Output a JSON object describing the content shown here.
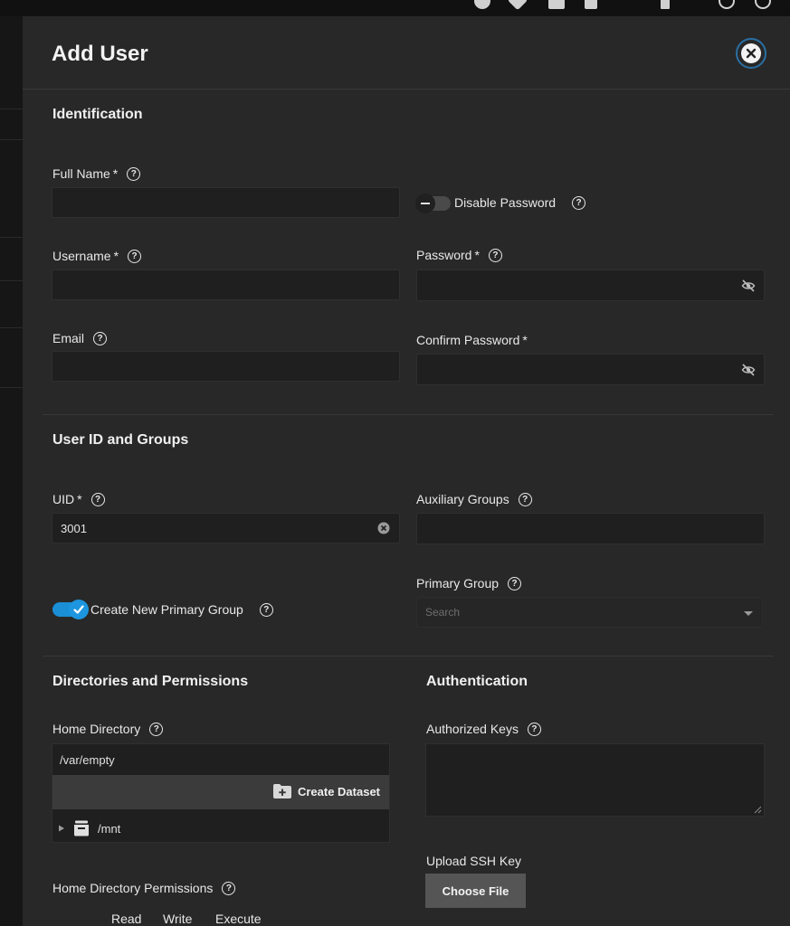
{
  "dialog": {
    "title": "Add User"
  },
  "sections": {
    "identification": "Identification",
    "user_id_groups": "User ID and Groups",
    "directories": "Directories and Permissions",
    "authentication": "Authentication"
  },
  "fields": {
    "full_name": {
      "label": "Full Name",
      "required": "*",
      "value": ""
    },
    "username": {
      "label": "Username",
      "required": "*",
      "value": ""
    },
    "email": {
      "label": "Email",
      "value": ""
    },
    "disable_password": {
      "label": "Disable Password",
      "checked": false
    },
    "password": {
      "label": "Password",
      "required": "*",
      "value": ""
    },
    "confirm_password": {
      "label": "Confirm Password",
      "required": "*",
      "value": ""
    },
    "uid": {
      "label": "UID",
      "required": "*",
      "value": "3001"
    },
    "auxiliary_groups": {
      "label": "Auxiliary Groups",
      "value": ""
    },
    "create_primary_group": {
      "label": "Create New Primary Group",
      "checked": true
    },
    "primary_group": {
      "label": "Primary Group",
      "placeholder": "Search"
    },
    "home_directory": {
      "label": "Home Directory",
      "value": "/var/empty",
      "create_dataset": "Create Dataset",
      "tree_root": "/mnt"
    },
    "authorized_keys": {
      "label": "Authorized Keys",
      "value": ""
    },
    "upload_ssh_key": {
      "label": "Upload SSH Key",
      "button": "Choose File"
    },
    "home_permissions": {
      "label": "Home Directory Permissions",
      "columns": [
        "Read",
        "Write",
        "Execute"
      ]
    }
  },
  "help_glyph": "?",
  "icons": {
    "close": "close-icon",
    "help": "help-circle-icon",
    "visibility": "eye-off-icon",
    "clear": "clear-icon",
    "check": "check-icon",
    "folder_add": "folder-plus-icon",
    "dataset": "dataset-icon",
    "expand": "triangle-right-icon",
    "dropdown": "chevron-down-icon"
  },
  "colors": {
    "accent": "#1a8fd6",
    "panel": "#282828",
    "input": "#1f1f1f",
    "button": "#555555"
  }
}
